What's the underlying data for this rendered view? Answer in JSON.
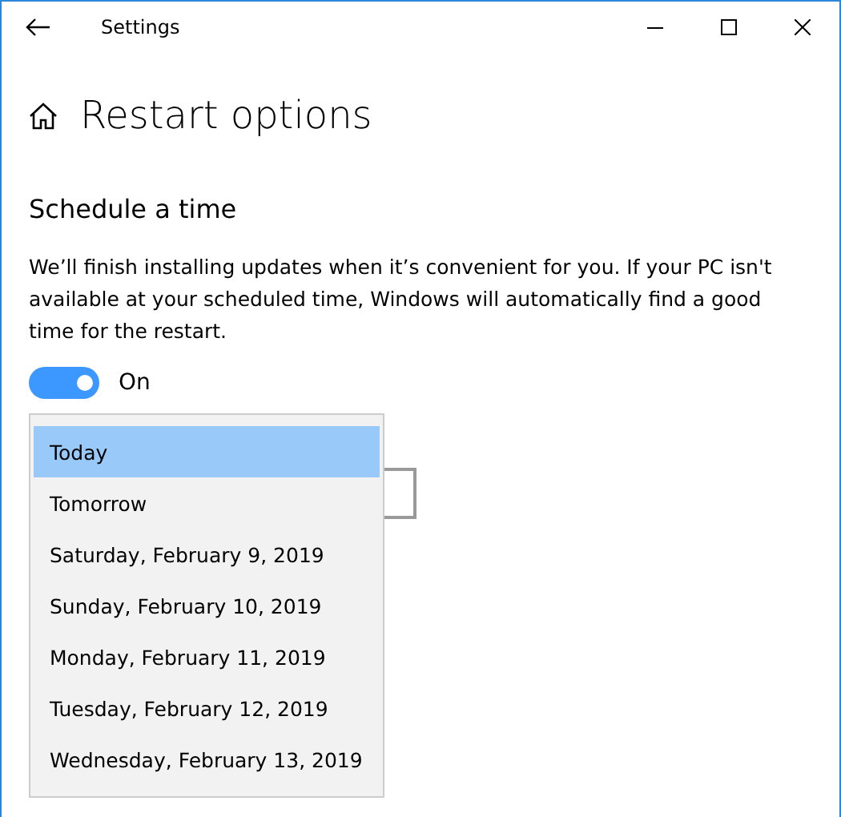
{
  "window": {
    "title": "Settings"
  },
  "page": {
    "title": "Restart options"
  },
  "section": {
    "heading": "Schedule a time",
    "description": "We’ll finish installing updates when it’s convenient for you. If your PC isn't available at your scheduled time, Windows will automatically find a good time for the restart."
  },
  "toggle": {
    "on": true,
    "label": "On"
  },
  "day_dropdown": {
    "expanded": true,
    "options": [
      {
        "label": "Today",
        "selected": true
      },
      {
        "label": "Tomorrow",
        "selected": false
      },
      {
        "label": "Saturday, February 9, 2019",
        "selected": false
      },
      {
        "label": "Sunday, February 10, 2019",
        "selected": false
      },
      {
        "label": "Monday, February 11, 2019",
        "selected": false
      },
      {
        "label": "Tuesday, February 12, 2019",
        "selected": false
      },
      {
        "label": "Wednesday, February 13, 2019",
        "selected": false
      }
    ]
  }
}
